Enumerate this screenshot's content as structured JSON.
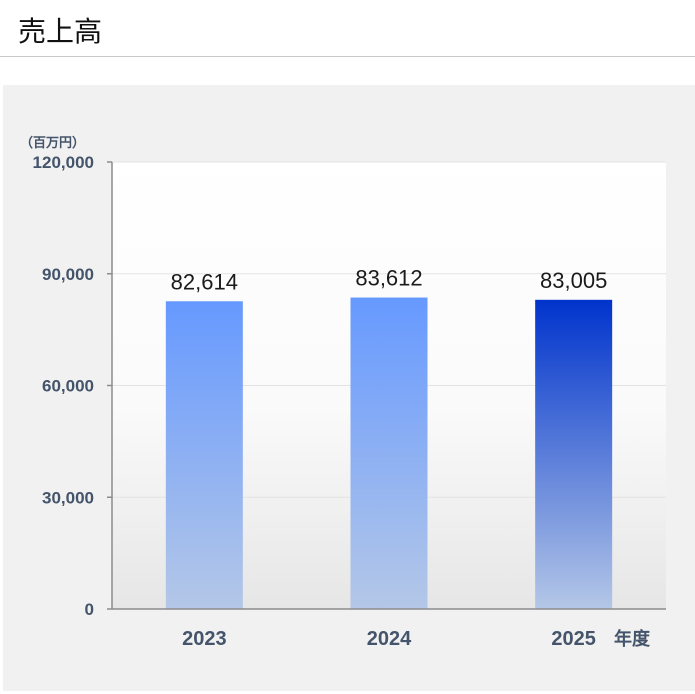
{
  "header": {
    "title": "売上高"
  },
  "chart_data": {
    "type": "bar",
    "unit_label": "（百万円）",
    "categories": [
      "2023",
      "2024",
      "2025"
    ],
    "x_suffix": "年度",
    "values": [
      82614,
      83612,
      83005
    ],
    "data_labels": [
      "82,614",
      "83,612",
      "83,005"
    ],
    "ylim": [
      0,
      120000
    ],
    "yticks": [
      0,
      30000,
      60000,
      90000,
      120000
    ],
    "ytick_labels": [
      "0",
      "30,000",
      "60,000",
      "90,000",
      "120,000"
    ],
    "grid": true,
    "bar_colors": {
      "regular_top": "#6699ff",
      "regular_bottom": "#b4c7e7",
      "highlight_top": "#0033cc",
      "highlight_bottom": "#b4c7e7"
    }
  }
}
